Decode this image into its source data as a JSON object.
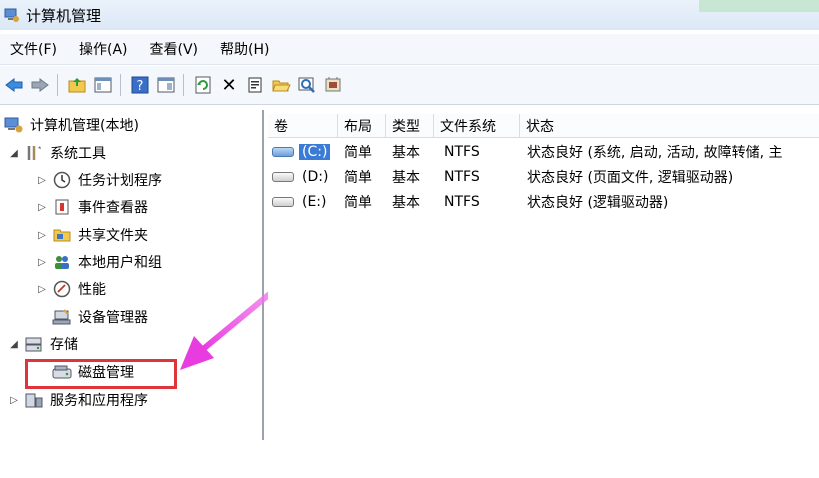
{
  "window": {
    "title": "计算机管理"
  },
  "menu": [
    "文件(F)",
    "操作(A)",
    "查看(V)",
    "帮助(H)"
  ],
  "toolbar": {
    "icons": [
      "back-arrow-icon",
      "forward-arrow-icon",
      "up-folder-icon",
      "show-hide-tree-icon",
      "help-icon",
      "export-view-icon",
      "refresh-icon",
      "delete-icon",
      "properties-icon",
      "open-folder-icon",
      "search-icon",
      "settings-icon"
    ],
    "delete_glyph": "✕"
  },
  "tree": {
    "root": "计算机管理(本地)",
    "system_tools": "系统工具",
    "task_scheduler": "任务计划程序",
    "event_viewer": "事件查看器",
    "shared_folders": "共享文件夹",
    "local_users": "本地用户和组",
    "performance": "性能",
    "device_manager": "设备管理器",
    "storage": "存储",
    "disk_management": "磁盘管理",
    "services_apps": "服务和应用程序"
  },
  "table": {
    "columns": [
      "卷",
      "布局",
      "类型",
      "文件系统",
      "状态"
    ],
    "rows": [
      {
        "volume": "(C:)",
        "layout": "简单",
        "type": "基本",
        "fs": "NTFS",
        "status": "状态良好 (系统, 启动, 活动, 故障转储, 主"
      },
      {
        "volume": "(D:)",
        "layout": "简单",
        "type": "基本",
        "fs": "NTFS",
        "status": "状态良好 (页面文件, 逻辑驱动器)"
      },
      {
        "volume": "(E:)",
        "layout": "简单",
        "type": "基本",
        "fs": "NTFS",
        "status": "状态良好 (逻辑驱动器)"
      }
    ]
  },
  "annotation": {
    "highlight_color": "#e0343b",
    "arrow_color": "#e83ce0"
  }
}
